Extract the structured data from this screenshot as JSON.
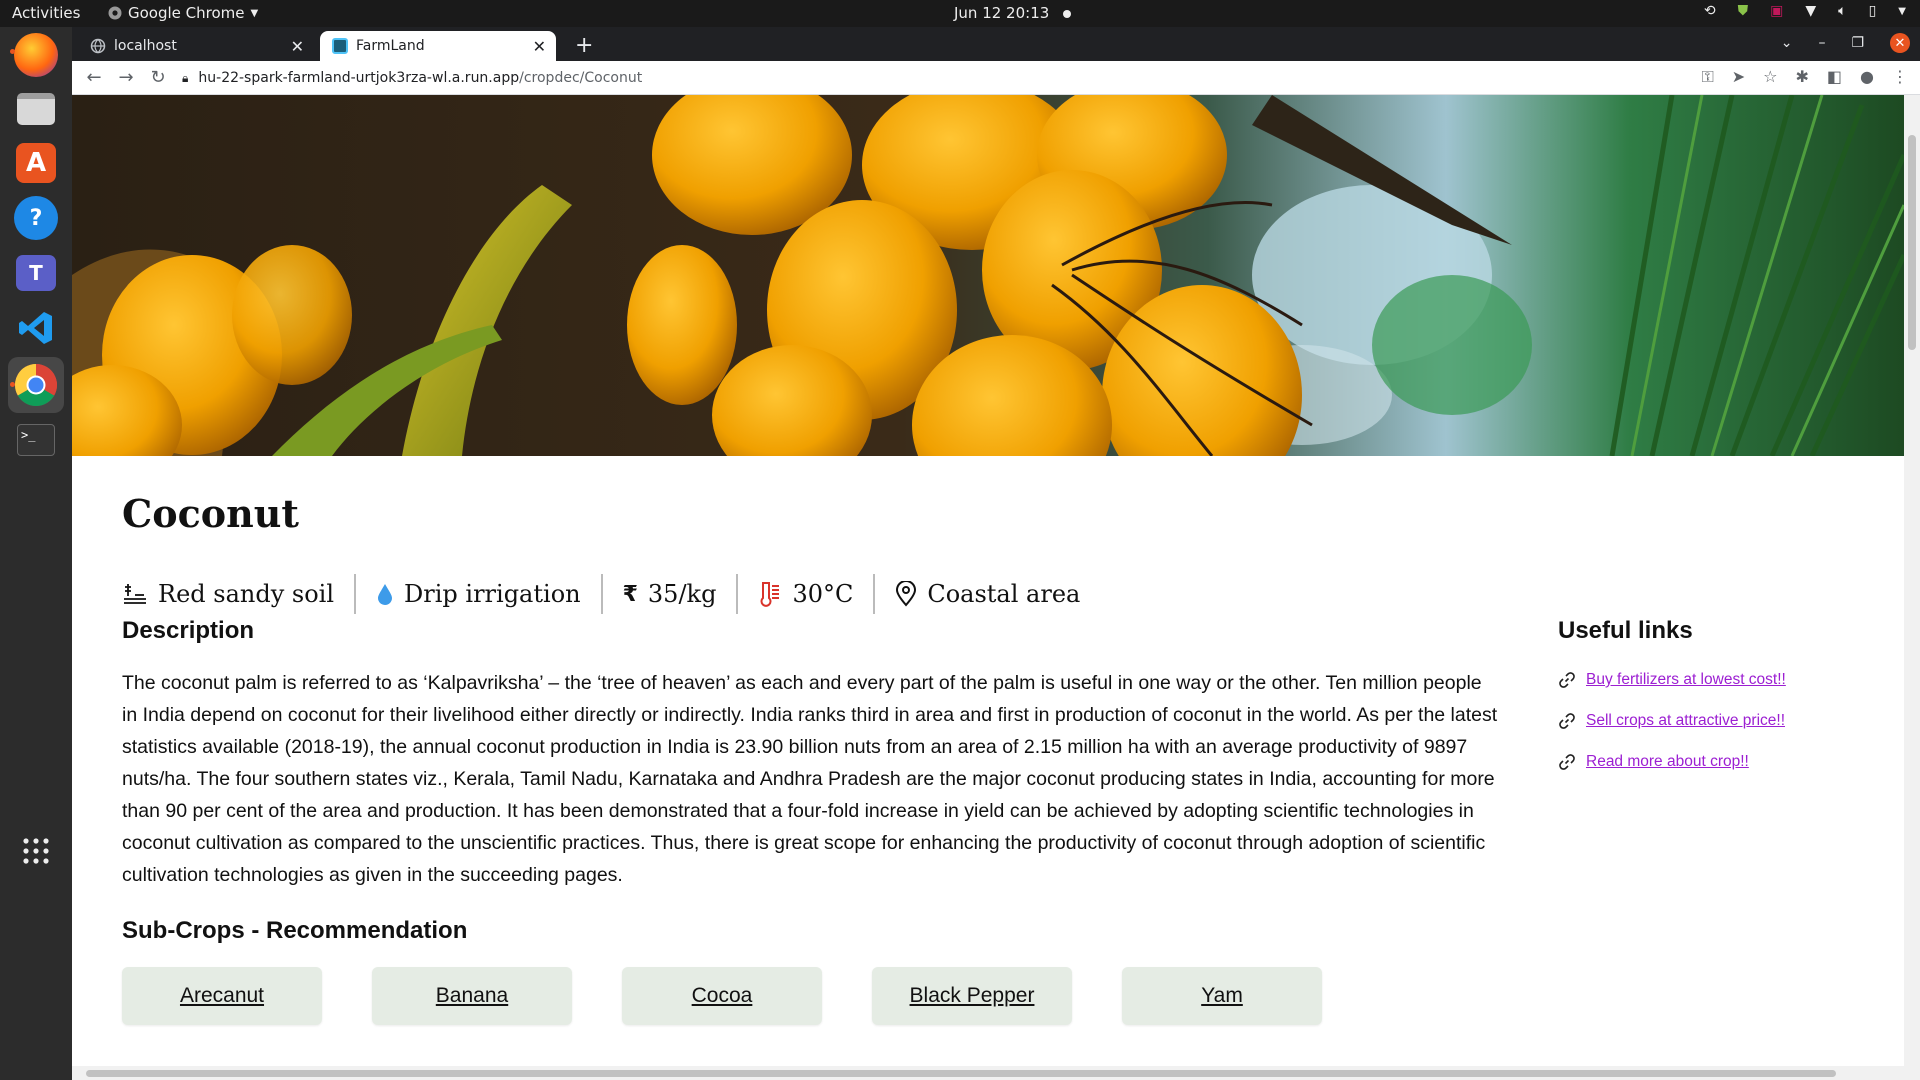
{
  "topbar": {
    "activities": "Activities",
    "app_name": "Google Chrome",
    "clock": "Jun 12  20:13"
  },
  "dock": {
    "items": [
      "Firefox",
      "Files",
      "Ubuntu Software",
      "Help",
      "Microsoft Teams",
      "Visual Studio Code",
      "Google Chrome",
      "Terminal",
      "Show Applications"
    ]
  },
  "browser": {
    "tabs": [
      {
        "label": "localhost",
        "active": false
      },
      {
        "label": "FarmLand",
        "active": true
      }
    ],
    "url_host": "hu-22-spark-farmland-urtjok3rza-wl.a.run.app",
    "url_path": "/cropdec/Coconut"
  },
  "page": {
    "title": "Coconut",
    "attributes": [
      {
        "icon": "soil-icon",
        "label": "Red sandy soil"
      },
      {
        "icon": "water-drop-icon",
        "label": "Drip irrigation"
      },
      {
        "icon": "rupee-icon",
        "label": "35/kg"
      },
      {
        "icon": "thermometer-icon",
        "label": "30°C"
      },
      {
        "icon": "location-pin-icon",
        "label": "Coastal area"
      }
    ],
    "description_heading": "Description",
    "description": "The coconut palm is referred to as ‘Kalpavriksha’ – the ‘tree of heaven’ as each and every part of the palm is useful in one way or the other. Ten million people in India depend on coconut for their livelihood either directly or indirectly. India ranks third in area and first in production of coconut in the world. As per the latest statistics available (2018-19), the annual coconut production in India is 23.90 billion nuts from an area of 2.15 million ha with an average productivity of 9897 nuts/ha. The four southern states viz., Kerala, Tamil Nadu, Karnataka and Andhra Pradesh are the major coconut producing states in India, accounting for more than 90 per cent of the area and production. It has been demonstrated that a four-fold increase in yield can be achieved by adopting scientific technologies in coconut cultivation as compared to the unscientific practices. Thus, there is great scope for enhancing the productivity of coconut through adoption of scientific cultivation technologies as given in the succeeding pages.",
    "subcrops_heading": "Sub-Crops - Recommendation",
    "subcrops": [
      "Arecanut",
      "Banana",
      "Cocoa",
      "Black Pepper",
      "Yam"
    ],
    "useful_links_heading": "Useful links",
    "useful_links": [
      "Buy fertilizers at lowest cost!!",
      "Sell crops at attractive price!!",
      "Read more about crop!!"
    ]
  },
  "colors": {
    "link": "#9c1fd2",
    "subcrop_bg": "#e5ece4",
    "ubuntu_accent": "#e95420"
  }
}
